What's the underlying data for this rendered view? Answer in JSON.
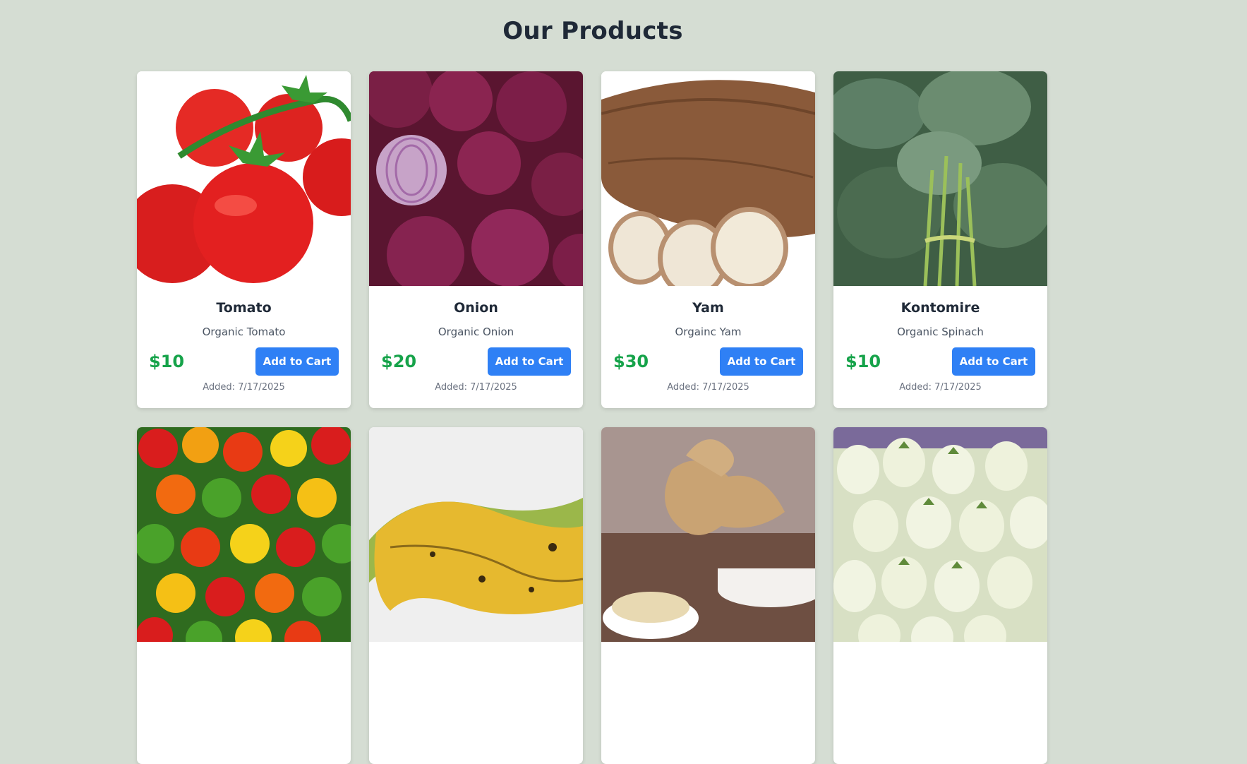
{
  "page": {
    "title": "Our Products"
  },
  "products": [
    {
      "name": "Tomato",
      "description": "Organic Tomato",
      "price": "$10",
      "button": "Add to Cart",
      "added": "Added: 7/17/2025"
    },
    {
      "name": "Onion",
      "description": "Organic Onion",
      "price": "$20",
      "button": "Add to Cart",
      "added": "Added: 7/17/2025"
    },
    {
      "name": "Yam",
      "description": "Orgainc Yam",
      "price": "$30",
      "button": "Add to Cart",
      "added": "Added: 7/17/2025"
    },
    {
      "name": "Kontomire",
      "description": "Organic Spinach",
      "price": "$10",
      "button": "Add to Cart",
      "added": "Added: 7/17/2025"
    }
  ],
  "colors": {
    "background": "#d5ddd3",
    "price": "#16a34a",
    "button": "#2f80f5"
  }
}
